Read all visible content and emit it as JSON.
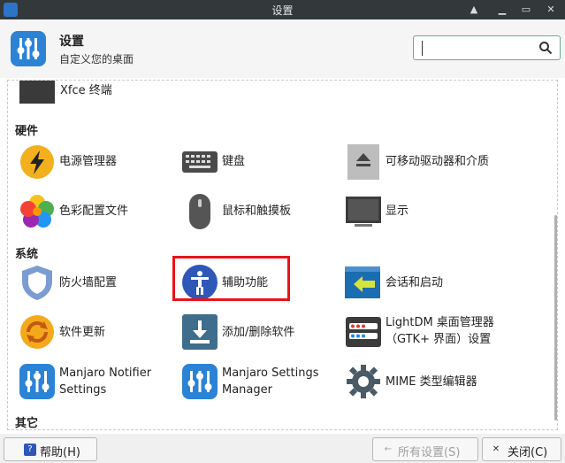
{
  "window": {
    "title": "设置"
  },
  "header": {
    "title": "设置",
    "subtitle": "自定义您的桌面",
    "search_value": ""
  },
  "sections": {
    "hardware": "硬件",
    "system": "系统",
    "other": "其它"
  },
  "items": {
    "xfce_terminal": "Xfce 终端",
    "power": "电源管理器",
    "keyboard": "键盘",
    "removable": "可移动驱动器和介质",
    "color": "色彩配置文件",
    "mouse": "鼠标和触摸板",
    "display": "显示",
    "firewall": "防火墙配置",
    "accessibility": "辅助功能",
    "session": "会话和启动",
    "software_update": "软件更新",
    "add_remove": "添加/删除软件",
    "lightdm_line1": "LightDM 桌面管理器",
    "lightdm_line2": "（GTK+ 界面）设置",
    "notifier_line1": "Manjaro Notifier",
    "notifier_line2": "Settings",
    "msm_line1": "Manjaro Settings",
    "msm_line2": "Manager",
    "mime": "MIME 类型编辑器"
  },
  "footer": {
    "help": "帮助(H)",
    "all_settings": "所有设置(S)",
    "close": "关闭(C)"
  },
  "colors": {
    "accent": "#2c83d5",
    "highlight": "#e8141b"
  }
}
